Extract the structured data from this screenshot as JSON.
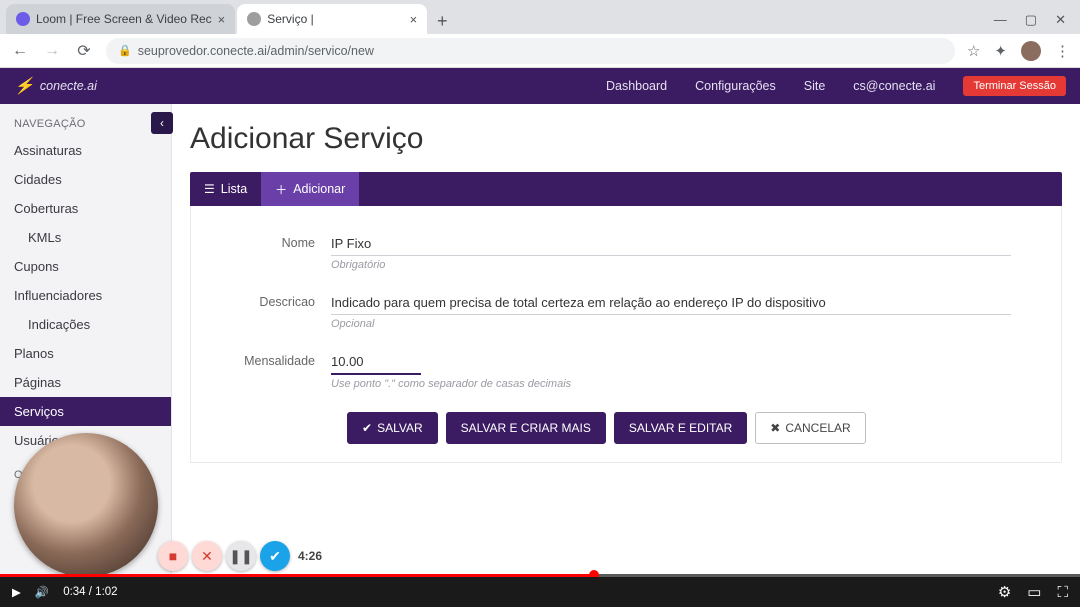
{
  "browser": {
    "tabs": [
      {
        "title": "Loom | Free Screen & Video Rec",
        "favicon_color": "#6c5ce7"
      },
      {
        "title": "Serviço |",
        "favicon_color": "#9e9e9e"
      }
    ],
    "url": "seuprovedor.conecte.ai/admin/servico/new",
    "win_min": "—",
    "win_max": "▢",
    "win_close": "✕"
  },
  "header": {
    "brand": "conecte.ai",
    "nav": {
      "dashboard": "Dashboard",
      "config": "Configurações",
      "site": "Site",
      "email": "cs@conecte.ai"
    },
    "terminate": "Terminar Sessão"
  },
  "sidebar": {
    "collapse_glyph": "‹",
    "section_nav": "NAVEGAÇÃO",
    "items": [
      {
        "label": "Assinaturas"
      },
      {
        "label": "Cidades"
      },
      {
        "label": "Coberturas"
      },
      {
        "label": "KMLs",
        "indent": true
      },
      {
        "label": "Cupons"
      },
      {
        "label": "Influenciadores"
      },
      {
        "label": "Indicações",
        "indent": true
      },
      {
        "label": "Planos"
      },
      {
        "label": "Páginas"
      },
      {
        "label": "Serviços",
        "active": true
      },
      {
        "label": "Usuários"
      }
    ],
    "section_other": "OUTROS"
  },
  "page": {
    "title": "Adicionar Serviço",
    "tab_list": "Lista",
    "tab_add": "Adicionar"
  },
  "form": {
    "nome": {
      "label": "Nome",
      "value": "IP Fixo",
      "hint": "Obrigatório"
    },
    "descricao": {
      "label": "Descricao",
      "value": "Indicado para quem precisa de total certeza em relação ao endereço IP do dispositivo",
      "hint": "Opcional"
    },
    "mensalidade": {
      "label": "Mensalidade",
      "value": "10.00",
      "hint": "Use ponto \".\" como separador de casas decimais"
    }
  },
  "buttons": {
    "save": "SALVAR",
    "save_more": "SALVAR E CRIAR MAIS",
    "save_edit": "SALVAR E EDITAR",
    "cancel": "CANCELAR"
  },
  "video": {
    "current": "0:34",
    "total": "1:02",
    "loom_time": "4:26"
  }
}
